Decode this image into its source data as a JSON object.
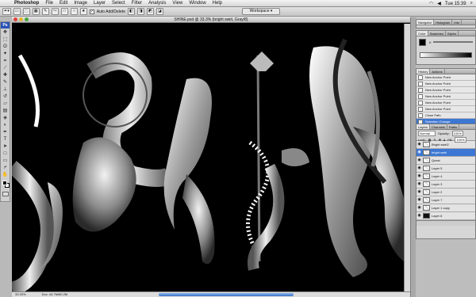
{
  "menubar": {
    "apple": "",
    "items": [
      "Photoshop",
      "File",
      "Edit",
      "Image",
      "Layer",
      "Select",
      "Filter",
      "Analysis",
      "View",
      "Window",
      "Help"
    ],
    "right_time": "Tue 15:39"
  },
  "options_bar": {
    "auto_add_label": "Auto Add/Delete",
    "workspace_label": "Workspace"
  },
  "document": {
    "title": "SHINE.psd @ 33.3% (bright swirl, Gray/8)",
    "zoom": "33.33%",
    "doc_info": "Doc: 44.7M/80.2M"
  },
  "colors": {
    "accent": "#3c77d4",
    "canvas": "#000000",
    "close_dot": "#e0443a",
    "min_dot": "#e5b532",
    "max_dot": "#49a73e"
  },
  "panels": {
    "navigator_tabs": [
      "Navigator",
      "Histogram",
      "Info"
    ],
    "color_tabs": [
      "Color",
      "Swatches",
      "Styles"
    ],
    "color_channel": "K",
    "history_tabs": [
      "History",
      "Actions"
    ],
    "history_items": [
      "New Anchor Point",
      "New Anchor Point",
      "New Anchor Point",
      "New Anchor Point",
      "New Anchor Point",
      "New Anchor Point",
      "Close Path",
      "Selection Change"
    ],
    "layers_tabs": [
      "Layers",
      "Channels",
      "Paths"
    ],
    "blend_mode": "Normal",
    "opacity_label": "Opacity:",
    "opacity_value": "100%",
    "lock_label": "Lock:",
    "fill_label": "Fill:",
    "fill_value": "100%",
    "layers": [
      {
        "name": "Bright swirl2",
        "selected": false,
        "dark": false
      },
      {
        "name": "bright swirl",
        "selected": true,
        "dark": false
      },
      {
        "name": "Quest",
        "selected": false,
        "dark": false
      },
      {
        "name": "Layer 5",
        "selected": false,
        "dark": false
      },
      {
        "name": "Layer 4",
        "selected": false,
        "dark": false
      },
      {
        "name": "Layer 3",
        "selected": false,
        "dark": false
      },
      {
        "name": "Layer 2",
        "selected": false,
        "dark": false
      },
      {
        "name": "Layer 7",
        "selected": false,
        "dark": false
      },
      {
        "name": "Layer 1 copy",
        "selected": false,
        "dark": false
      },
      {
        "name": "Layer 6",
        "selected": false,
        "dark": true
      }
    ]
  }
}
